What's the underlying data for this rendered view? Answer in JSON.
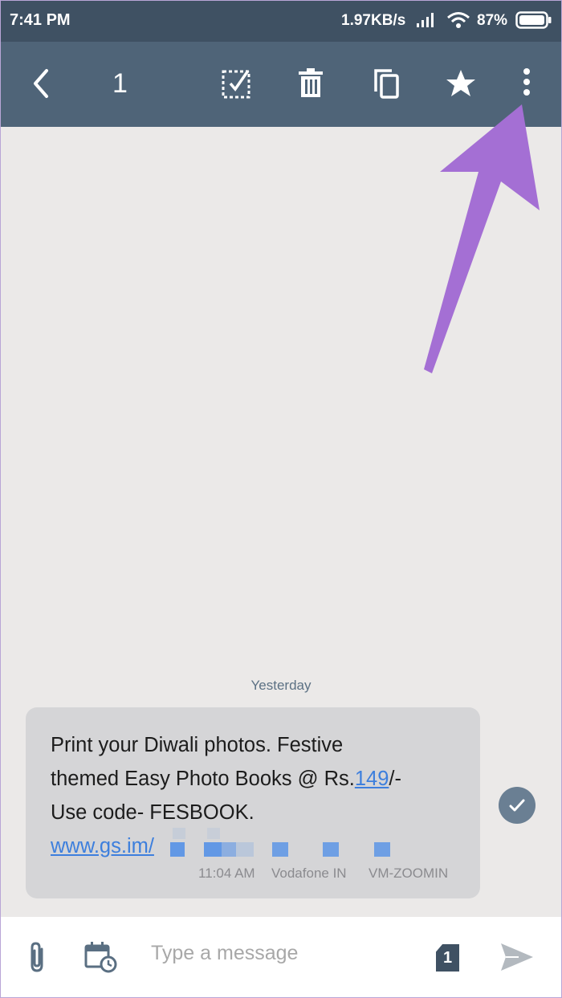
{
  "status_bar": {
    "time": "7:41 PM",
    "network_speed": "1.97KB/s",
    "battery_percent": "87%"
  },
  "toolbar": {
    "selected_count": "1",
    "icons": [
      "back-icon",
      "select-all-icon",
      "delete-icon",
      "copy-icon",
      "star-icon",
      "more-options-icon"
    ]
  },
  "conversation": {
    "date_separator": "Yesterday",
    "message": {
      "line1": "Print your Diwali photos. Festive",
      "line2_prefix": "themed Easy Photo Books @ Rs.",
      "line2_link": "149",
      "line2_suffix": "/-",
      "line3": "Use code- FESBOOK.",
      "link": "www.gs.im/",
      "time": "11:04 AM",
      "carrier": "Vodafone IN",
      "sender": "VM-ZOOMIN"
    }
  },
  "composer": {
    "placeholder": "Type a message",
    "sim_label": "1"
  },
  "colors": {
    "status_bar": "#3f5163",
    "toolbar": "#4f6478",
    "background": "#ebe9e8",
    "bubble": "#d5d5d7",
    "link": "#3d7fdd",
    "annotation_arrow": "#a46fd4"
  }
}
